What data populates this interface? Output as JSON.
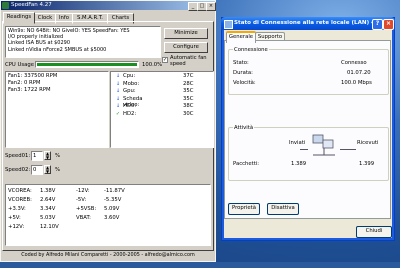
{
  "speedfan": {
    "title": "SpeedFan 4.27",
    "tabs": [
      "Readings",
      "Clock",
      "Info",
      "S.M.A.R.T.",
      "Charts"
    ],
    "log_lines": [
      "Win9x: NO  64Bit: NO  GiveIO: YES  SpeedFan: YES",
      "I/O properly initialized",
      "Linked ISA BUS at $0290",
      "Linked nVidia nForce2 SMBUS at $5000"
    ],
    "minimize_label": "Minimize",
    "configure_label": "Configure",
    "auto_fan_label": "Automatic fan speed",
    "auto_fan_checked": true,
    "cpu_usage_label": "CPU Usage",
    "cpu_usage_value": "100.0%",
    "cpu_usage_fraction": 1.0,
    "fans": [
      "Fan1: 337500 RPM",
      "Fan2: 0 RPM",
      "Fan3: 1722 RPM"
    ],
    "temps": [
      {
        "icon": "down-arrow-icon",
        "name": "Cpu:",
        "value": "37C"
      },
      {
        "icon": "down-arrow-icon",
        "name": "Mobo:",
        "value": "28C"
      },
      {
        "icon": "down-arrow-icon",
        "name": "Gpu:",
        "value": "35C"
      },
      {
        "icon": "down-arrow-icon",
        "name": "Scheda video:",
        "value": "35C"
      },
      {
        "icon": "down-arrow-icon",
        "name": "HD0:",
        "value": "38C"
      },
      {
        "icon": "check-icon",
        "name": "HD2:",
        "value": "30C"
      }
    ],
    "speed01_label": "Speed01:",
    "speed01_value": "1",
    "speed02_label": "Speed02:",
    "speed02_value": "0",
    "percent_label": "%",
    "voltages_left": [
      {
        "name": "VCOREA:",
        "value": "1.38V"
      },
      {
        "name": "VCOREB:",
        "value": "2.64V"
      },
      {
        "name": "+3.3V:",
        "value": "3.34V"
      },
      {
        "name": "+5V:",
        "value": "5.03V"
      },
      {
        "name": "+12V:",
        "value": "12.10V"
      }
    ],
    "voltages_right": [
      {
        "name": "-12V:",
        "value": "-11.87V"
      },
      {
        "name": "-5V:",
        "value": "-5.35V"
      },
      {
        "name": "+5VSB:",
        "value": "5.09V"
      },
      {
        "name": "VBAT:",
        "value": "3.60V"
      }
    ],
    "footer": "Coded by Alfredo Milani Comparetti - 2000-2005 - alfredo@almico.com"
  },
  "connection": {
    "title": "Stato di Connessione alla rete locale (LAN) 4",
    "tabs": [
      "Generale",
      "Supporto"
    ],
    "connection_group": "Connessione",
    "status_label": "Stato:",
    "status_value": "Connesso",
    "duration_label": "Durata:",
    "duration_value": "01.07.20",
    "speed_label": "Velocità:",
    "speed_value": "100.0 Mbps",
    "activity_group": "Attività",
    "sent_label": "Inviati",
    "received_label": "Ricevuti",
    "packets_label": "Pacchetti:",
    "packets_sent": "1.389",
    "packets_received": "1.399",
    "properties_label": "Proprietà",
    "disable_label": "Disattiva",
    "close_label": "Chiudi"
  }
}
